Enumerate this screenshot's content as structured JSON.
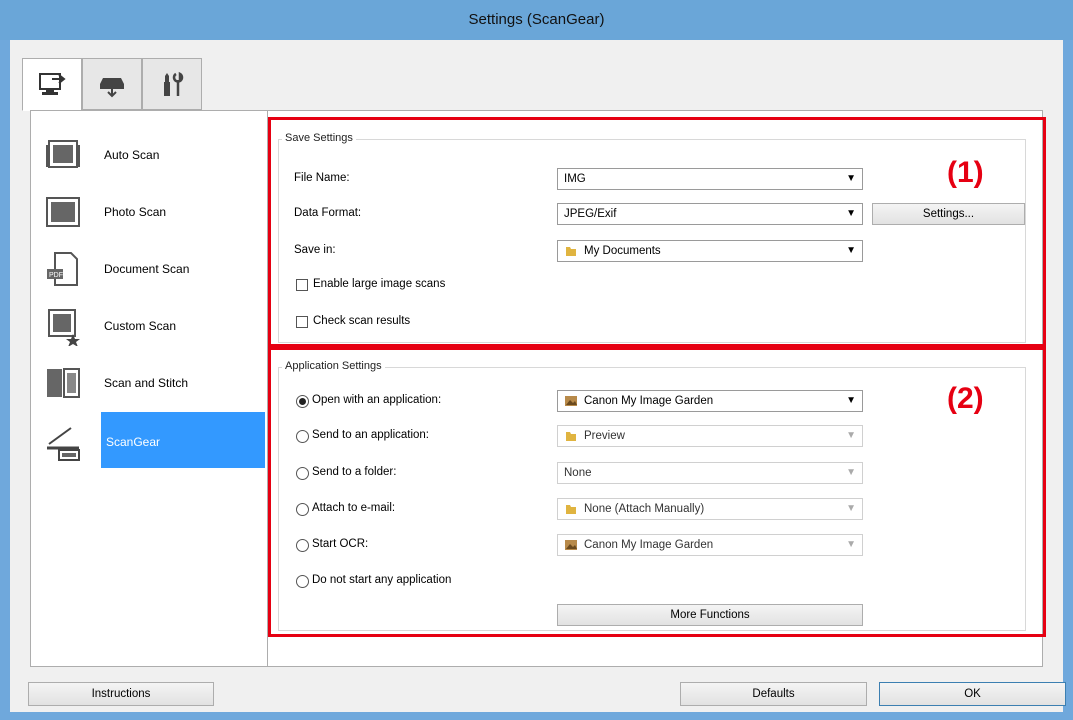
{
  "window": {
    "title": "Settings (ScanGear)"
  },
  "tabs": [
    {
      "icon": "scan-from-computer-icon",
      "active": true
    },
    {
      "icon": "scan-from-panel-icon",
      "active": false
    },
    {
      "icon": "general-settings-icon",
      "active": false
    }
  ],
  "nav": [
    {
      "label": "Auto Scan",
      "icon": "auto-scan-icon"
    },
    {
      "label": "Photo Scan",
      "icon": "photo-scan-icon"
    },
    {
      "label": "Document Scan",
      "icon": "document-scan-icon"
    },
    {
      "label": "Custom Scan",
      "icon": "custom-scan-icon"
    },
    {
      "label": "Scan and Stitch",
      "icon": "scan-and-stitch-icon"
    },
    {
      "label": "ScanGear",
      "icon": "scangear-icon",
      "selected": true
    }
  ],
  "save_settings": {
    "group_label": "Save Settings",
    "file_name_label": "File Name:",
    "file_name_value": "IMG",
    "data_format_label": "Data Format:",
    "data_format_value": "JPEG/Exif",
    "settings_button": "Settings...",
    "save_in_label": "Save in:",
    "save_in_value": "My Documents",
    "enable_large_label": "Enable large image scans",
    "check_results_label": "Check scan results",
    "callout": "(1)"
  },
  "app_settings": {
    "group_label": "Application Settings",
    "callout": "(2)",
    "options": [
      {
        "label": "Open with an application:",
        "value": "Canon My Image Garden",
        "checked": true,
        "enabled": true,
        "icon": "image-garden-icon"
      },
      {
        "label": "Send to an application:",
        "value": "Preview",
        "checked": false,
        "enabled": false,
        "icon": "folder-icon"
      },
      {
        "label": "Send to a folder:",
        "value": "None",
        "checked": false,
        "enabled": false,
        "icon": ""
      },
      {
        "label": "Attach to e-mail:",
        "value": "None (Attach Manually)",
        "checked": false,
        "enabled": false,
        "icon": "folder-icon"
      },
      {
        "label": "Start OCR:",
        "value": "Canon My Image Garden",
        "checked": false,
        "enabled": false,
        "icon": "image-garden-icon"
      },
      {
        "label": "Do not start any application",
        "checked": false
      }
    ],
    "more_functions_button": "More Functions"
  },
  "footer": {
    "instructions_button": "Instructions",
    "defaults_button": "Defaults",
    "ok_button": "OK"
  },
  "colors": {
    "highlight": "#e60012",
    "selection": "#3399ff",
    "title_bar": "#6aa6d8"
  }
}
